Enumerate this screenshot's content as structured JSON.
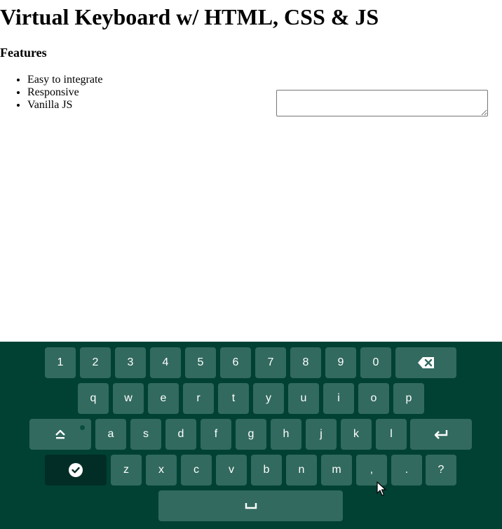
{
  "page": {
    "title": "Virtual Keyboard w/ HTML, CSS & JS",
    "features_heading": "Features",
    "features": [
      "Easy to integrate",
      "Responsive",
      "Vanilla JS"
    ],
    "textarea_value": ""
  },
  "keyboard": {
    "row1": [
      "1",
      "2",
      "3",
      "4",
      "5",
      "6",
      "7",
      "8",
      "9",
      "0"
    ],
    "row2": [
      "q",
      "w",
      "e",
      "r",
      "t",
      "y",
      "u",
      "i",
      "o",
      "p"
    ],
    "row3": [
      "a",
      "s",
      "d",
      "f",
      "g",
      "h",
      "j",
      "k",
      "l"
    ],
    "row4": [
      "z",
      "x",
      "c",
      "v",
      "b",
      "n",
      "m",
      ",",
      ".",
      "?"
    ],
    "icons": {
      "backspace": "backspace-icon",
      "caps_lock": "caps-lock-icon",
      "enter": "enter-icon",
      "done": "check-circle-icon",
      "space": "space-bar-icon"
    },
    "colors": {
      "background": "#004134",
      "key": "#326a5f",
      "key_dark": "#012d26",
      "text": "#ffffff"
    }
  }
}
